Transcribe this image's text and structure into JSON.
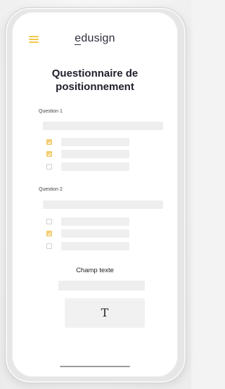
{
  "header": {
    "menu_icon": "hamburger-icon",
    "logo_text": "edusign"
  },
  "title": "Questionnaire de positionnement",
  "questions": [
    {
      "label": "Question 1",
      "options": [
        {
          "checked": true
        },
        {
          "checked": true
        },
        {
          "checked": false
        }
      ]
    },
    {
      "label": "Question 2",
      "options": [
        {
          "checked": false
        },
        {
          "checked": true
        },
        {
          "checked": false
        }
      ]
    }
  ],
  "text_field": {
    "label": "Champ texte",
    "icon_glyph": "T"
  },
  "colors": {
    "accent": "#f2c84b",
    "checkbox_checked": "#f6d27a",
    "placeholder_bar": "#eeeeee"
  }
}
